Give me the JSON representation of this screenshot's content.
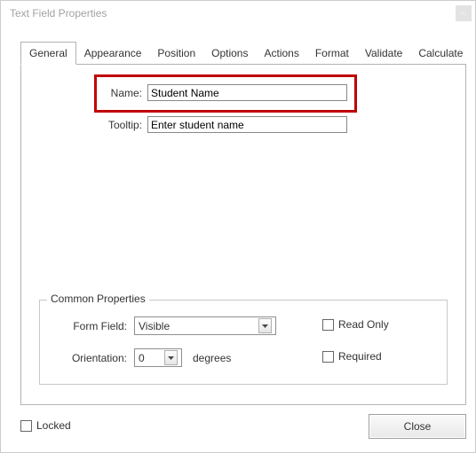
{
  "window": {
    "title": "Text Field Properties"
  },
  "tabs": [
    {
      "label": "General"
    },
    {
      "label": "Appearance"
    },
    {
      "label": "Position"
    },
    {
      "label": "Options"
    },
    {
      "label": "Actions"
    },
    {
      "label": "Format"
    },
    {
      "label": "Validate"
    },
    {
      "label": "Calculate"
    }
  ],
  "general": {
    "name_label": "Name:",
    "name_value": "Student Name",
    "tooltip_label": "Tooltip:",
    "tooltip_value": "Enter student name"
  },
  "common": {
    "legend": "Common Properties",
    "form_field_label": "Form Field:",
    "form_field_value": "Visible",
    "orientation_label": "Orientation:",
    "orientation_value": "0",
    "orientation_suffix": "degrees",
    "read_only_label": "Read Only",
    "required_label": "Required"
  },
  "footer": {
    "locked_label": "Locked",
    "close_label": "Close"
  }
}
